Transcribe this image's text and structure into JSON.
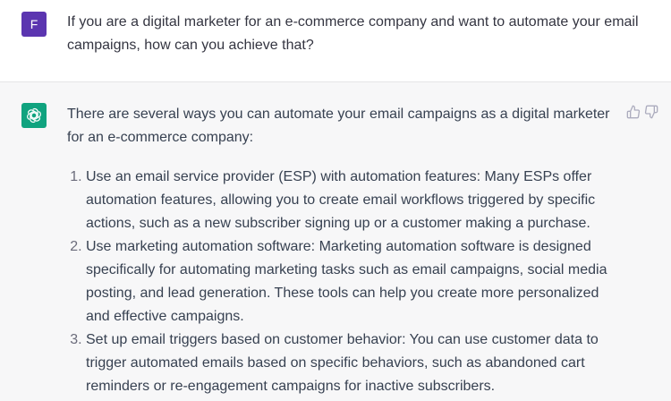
{
  "user": {
    "avatar_letter": "F",
    "avatar_color": "#5b35b0",
    "message": "If you are a digital marketer for an e-commerce company and want to automate your email campaigns, how can you achieve that?"
  },
  "assistant": {
    "avatar_icon": "openai-logo-icon",
    "avatar_color": "#10a37f",
    "intro": "There are several ways you can automate your email campaigns as a digital marketer for an e-commerce company:",
    "items": [
      "Use an email service provider (ESP) with automation features: Many ESPs offer automation features, allowing you to create email workflows triggered by specific actions, such as a new subscriber signing up or a customer making a purchase.",
      "Use marketing automation software: Marketing automation software is designed specifically for automating marketing tasks such as email campaigns, social media posting, and lead generation. These tools can help you create more personalized and effective campaigns.",
      "Set up email triggers based on customer behavior: You can use customer data to trigger automated emails based on specific behaviors, such as abandoned cart reminders or re-engagement campaigns for inactive subscribers."
    ],
    "feedback": {
      "up_icon": "thumbs-up-icon",
      "down_icon": "thumbs-down-icon"
    }
  }
}
